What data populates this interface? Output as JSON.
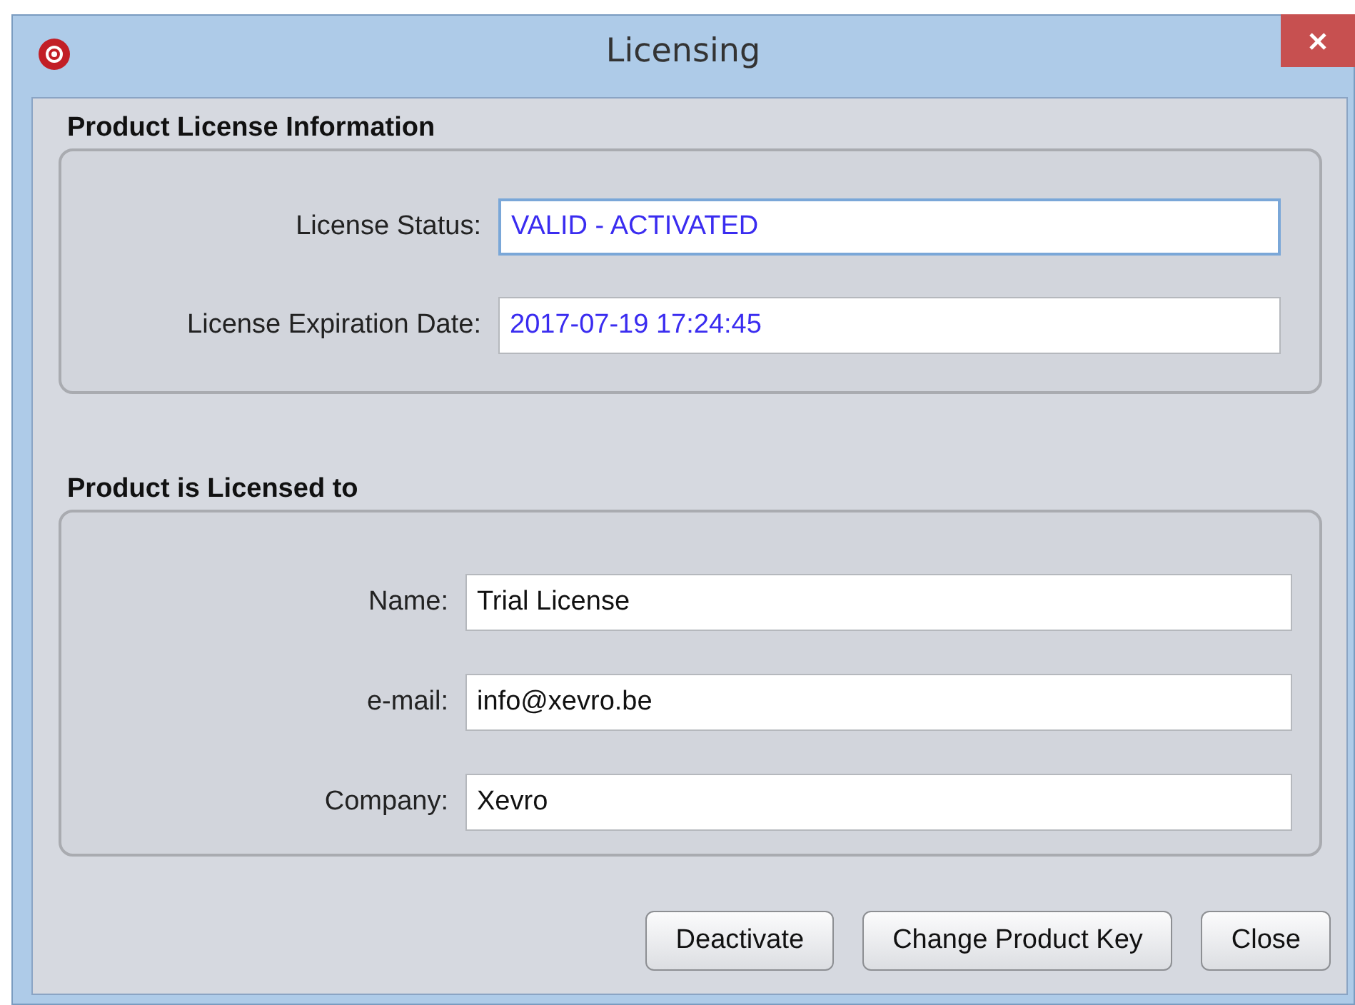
{
  "window": {
    "title": "Licensing"
  },
  "sections": [
    {
      "title": "Product License Information",
      "fields": [
        {
          "label": "License Status:",
          "value": "VALID - ACTIVATED",
          "kind": "info",
          "focused": true
        },
        {
          "label": "License Expiration Date:",
          "value": "2017-07-19 17:24:45",
          "kind": "info",
          "focused": false
        }
      ]
    },
    {
      "title": "Product is Licensed to",
      "fields": [
        {
          "label": "Name:",
          "value": "Trial License",
          "kind": "entry",
          "focused": false
        },
        {
          "label": "e-mail:",
          "value": "info@xevro.be",
          "kind": "entry",
          "focused": false
        },
        {
          "label": "Company:",
          "value": "Xevro",
          "kind": "entry",
          "focused": false
        }
      ]
    }
  ],
  "buttons": [
    "Deactivate",
    "Change Product Key",
    "Close"
  ]
}
